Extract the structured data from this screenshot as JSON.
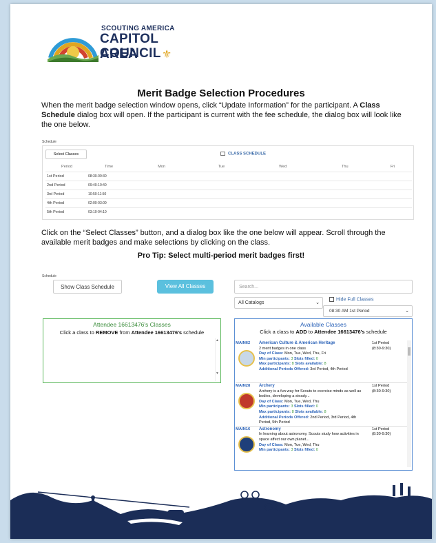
{
  "logo": {
    "line1": "SCOUTING AMERICA",
    "line2": "CAPITOL AREA",
    "line3": "COUNCIL",
    "colors": {
      "navy": "#1d2f5c",
      "gold": "#e0a520"
    }
  },
  "heading": "Merit Badge Selection Procedures",
  "para1": {
    "part1": "When the merit badge selection window opens, click “Update Information” for the participant.  A ",
    "bold1": "Class Schedule",
    "part2": " dialog box will open.  If the participant is current with the fee schedule, the dialog box will look like the one below."
  },
  "schedule_box": {
    "label": "Schedule",
    "select_button": "Select Classes",
    "title": "CLASS SCHEDULE",
    "columns": [
      "Period",
      "Time",
      "Mon",
      "Tue",
      "Wed",
      "Thu",
      "Fri"
    ],
    "rows": [
      {
        "period": "1st Period",
        "time": "08:30-09:30"
      },
      {
        "period": "2nd Period",
        "time": "09:40-10:40"
      },
      {
        "period": "3rd Period",
        "time": "10:50-11:50"
      },
      {
        "period": "4th Period",
        "time": "02:00-03:00"
      },
      {
        "period": "5th Period",
        "time": "03:10-04:10"
      }
    ]
  },
  "para2": "Click on the “Select Classes” button, and a dialog box like the one below will appear.  Scroll through the available merit badges and make selections by clicking on the class.",
  "protip": "Pro Tip: Select multi-period merit badges first!",
  "dialog": {
    "label": "Schedule",
    "show_schedule": "Show Class Schedule",
    "view_all": "View All Classes",
    "search_placeholder": "Search...",
    "catalog_value": "All Catalogs",
    "hide_full": "Hide Full Classes",
    "period_value": "08:30 AM 1st Period",
    "attendee": {
      "title": "Attendee 16613476's Classes",
      "sub_pre": "Click a class to ",
      "sub_bold1": "REMOVE",
      "sub_mid": " from ",
      "sub_bold2": "Attendee 16613476's",
      "sub_post": " schedule"
    },
    "available": {
      "title": "Available Classes",
      "sub_pre": "Click a class to ",
      "sub_bold1": "ADD",
      "sub_mid": " to ",
      "sub_bold2": "Attendee 16613476's",
      "sub_post": " schedule",
      "classes": [
        {
          "code": "MAIN62",
          "name": "American Culture & American Heritage",
          "desc": "2 merit badges in one class",
          "days_label": "Day of Class:",
          "days": "Mon, Tue, Wed, Thu, Fri",
          "min_label": "Min participants:",
          "min": "3",
          "filled_label": "Slots filled:",
          "filled": "0",
          "max_label": "Max participants:",
          "max": "8",
          "avail_label": "Slots available:",
          "avail": "8",
          "addl_label": "Additional Periods Offered:",
          "addl": "3rd Period, 4th Period",
          "period": "1st Period",
          "time": "(8:30-9:30)",
          "badge_color": "#c8d8e8"
        },
        {
          "code": "MAIN28",
          "name": "Archery",
          "desc": "Archery is a fun way for Scouts to exercise minds as well as bodies, developing a steady...",
          "days_label": "Day of Class:",
          "days": "Mon, Tue, Wed, Thu",
          "min_label": "Min participants:",
          "min": "3",
          "filled_label": "Slots filled:",
          "filled": "0",
          "max_label": "Max participants:",
          "max": "8",
          "avail_label": "Slots available:",
          "avail": "8",
          "addl_label": "Additional Periods Offered:",
          "addl": "2nd Period, 3rd Period, 4th Period, 5th Period",
          "period": "1st Period",
          "time": "(8:30-9:30)",
          "badge_color": "#c0392b"
        },
        {
          "code": "MAIN16",
          "name": "Astronomy",
          "desc": "In learning about astronomy, Scouts study how activities in space affect our own planet...",
          "days_label": "Day of Class:",
          "days": "Mon, Tue, Wed, Thu",
          "min_label": "Min participants:",
          "min": "3",
          "filled_label": "Slots filled:",
          "filled": "0",
          "max_label": "",
          "max": "",
          "avail_label": "",
          "avail": "",
          "addl_label": "",
          "addl": "",
          "period": "1st Period",
          "time": "(8:30-9:30)",
          "badge_color": "#1f3f7a"
        }
      ]
    }
  }
}
